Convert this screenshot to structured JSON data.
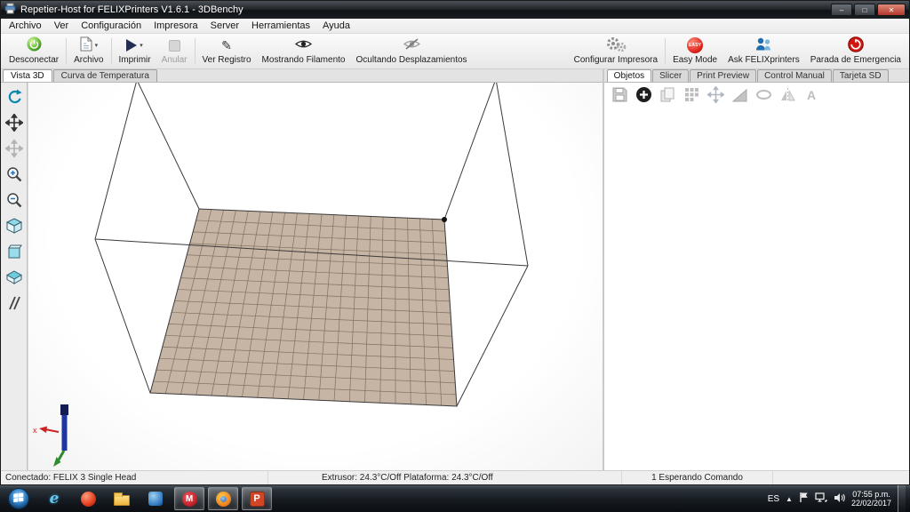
{
  "window": {
    "title": "Repetier-Host for FELIXPrinters V1.6.1 - 3DBenchy",
    "caption": {
      "minimize": "–",
      "maximize": "□",
      "close": "✕"
    }
  },
  "menu": {
    "items": [
      {
        "label": "Archivo"
      },
      {
        "label": "Ver"
      },
      {
        "label": "Configuración"
      },
      {
        "label": "Impresora"
      },
      {
        "label": "Server"
      },
      {
        "label": "Herramientas"
      },
      {
        "label": "Ayuda"
      }
    ]
  },
  "toolbar": {
    "dropdown_glyph": "▾",
    "easy_badge": "EASY",
    "buttons": {
      "desconectar": "Desconectar",
      "archivo": "Archivo",
      "imprimir": "Imprimir",
      "anular": "Anular",
      "ver_registro": "Ver Registro",
      "mostrando_filamento": "Mostrando Filamento",
      "ocultando_desplazamientos": "Ocultando Desplazamientos",
      "configurar_impresora": "Configurar Impresora",
      "easy_mode": "Easy Mode",
      "ask_felix": "Ask FELIXprinters",
      "parada_emergencia": "Parada de Emergencia"
    }
  },
  "view_tabs": {
    "vista_3d": "Vista 3D",
    "curva_temperatura": "Curva de Temperatura"
  },
  "right_panel": {
    "tabs": [
      {
        "label": "Objetos"
      },
      {
        "label": "Slicer"
      },
      {
        "label": "Print Preview"
      },
      {
        "label": "Control Manual"
      },
      {
        "label": "Tarjeta SD"
      }
    ]
  },
  "statusbar": {
    "connection": "Conectado: FELIX 3 Single Head",
    "temperatures": "Extrusor: 24.3°C/Off Plataforma: 24.3°C/Off",
    "queue": "1 Esperando Comando"
  },
  "taskbar": {
    "language": "ES",
    "tray_expand": "▲",
    "time": "07:55 p.m.",
    "date": "22/02/2017",
    "icons": {
      "ie_letter": "e",
      "makerware_letter": "M",
      "powerpoint_letter": "P"
    }
  },
  "scene": {
    "bed_color": "#c6b4a4",
    "bed_grid_color": "#82715f",
    "frame_color": "#3a3a3a",
    "axis": {
      "x_label": "x"
    },
    "geometry": {
      "bed": {
        "bl": [
          192,
          142
        ],
        "br": [
          468,
          154
        ],
        "fr": [
          482,
          364
        ],
        "fl": [
          137,
          349
        ]
      },
      "top": {
        "tbl": [
          122,
          -3
        ],
        "tbr": [
          526,
          -4
        ],
        "tfl": [
          75,
          176
        ],
        "tfr": [
          562,
          206
        ]
      },
      "grid": {
        "cols": 20,
        "rows": 16
      },
      "origin_dot": [
        468,
        154
      ]
    }
  }
}
